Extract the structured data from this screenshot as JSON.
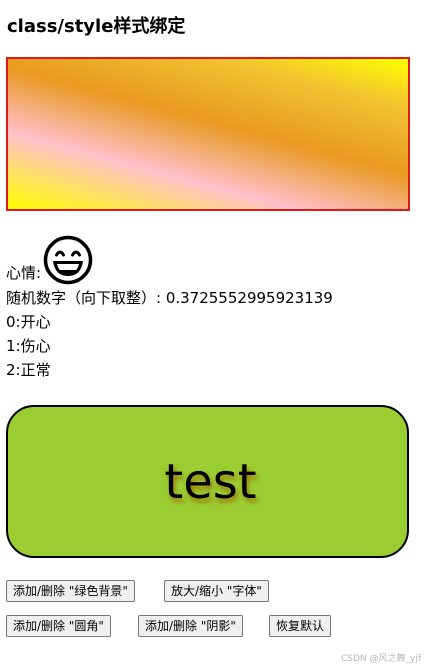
{
  "page": {
    "title": "class/style样式绑定"
  },
  "mood": {
    "label": "心情:",
    "icon": "grinning-face-icon"
  },
  "info": {
    "random_line": "随机数字（向下取整）: 0.3725552995923139",
    "options": [
      "0:开心",
      "1:伤心",
      "2:正常"
    ]
  },
  "test_box": {
    "text": "test",
    "background_color": "#9acd32"
  },
  "buttons": {
    "toggle_green_bg": "添加/删除 \"绿色背景\"",
    "toggle_font_size": "放大/缩小 \"字体\"",
    "toggle_radius": "添加/删除 \"圆角\"",
    "toggle_shadow": "添加/删除 \"阴影\"",
    "reset": "恢复默认"
  },
  "watermark": "CSDN @风之舞_yjf"
}
